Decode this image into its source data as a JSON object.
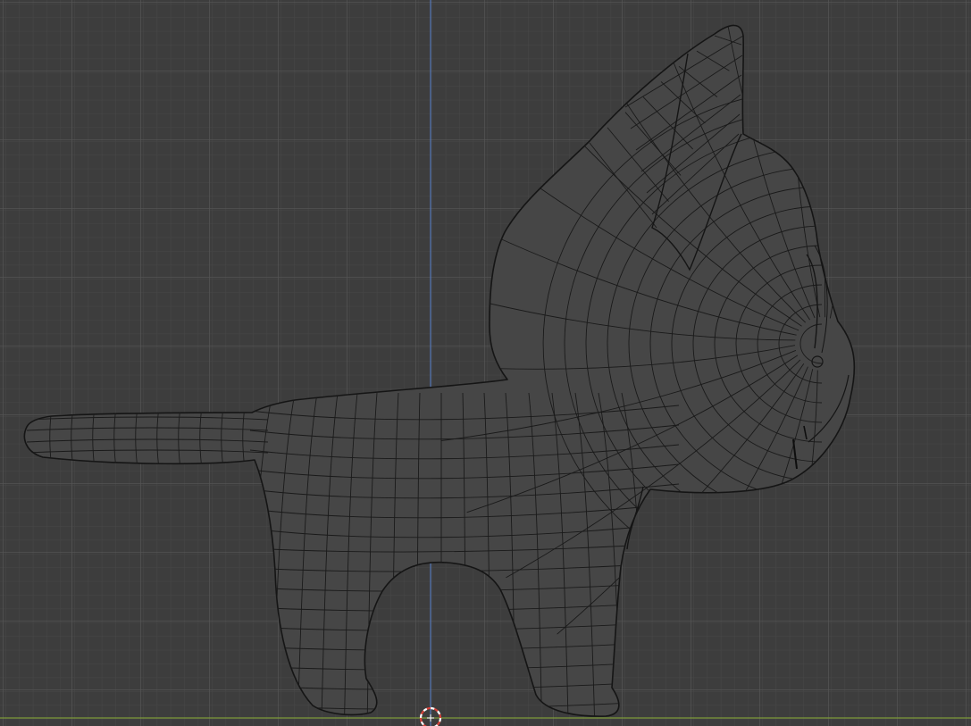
{
  "viewport": {
    "mode": "orthographic-side-view",
    "display": "wireframe-overlay",
    "object": "cat-mesh",
    "colors": {
      "background": "#3d3d3d",
      "grid_minor": "#474747",
      "grid_major": "#535353",
      "axis_z": "#5577b8",
      "axis_y": "#7d9a3a",
      "mesh_fill": "#464646",
      "mesh_wire": "#151515",
      "cursor_ring_red": "#d9423a",
      "cursor_ring_white": "#ffffff"
    },
    "icons": [
      "3d-cursor-icon"
    ]
  }
}
